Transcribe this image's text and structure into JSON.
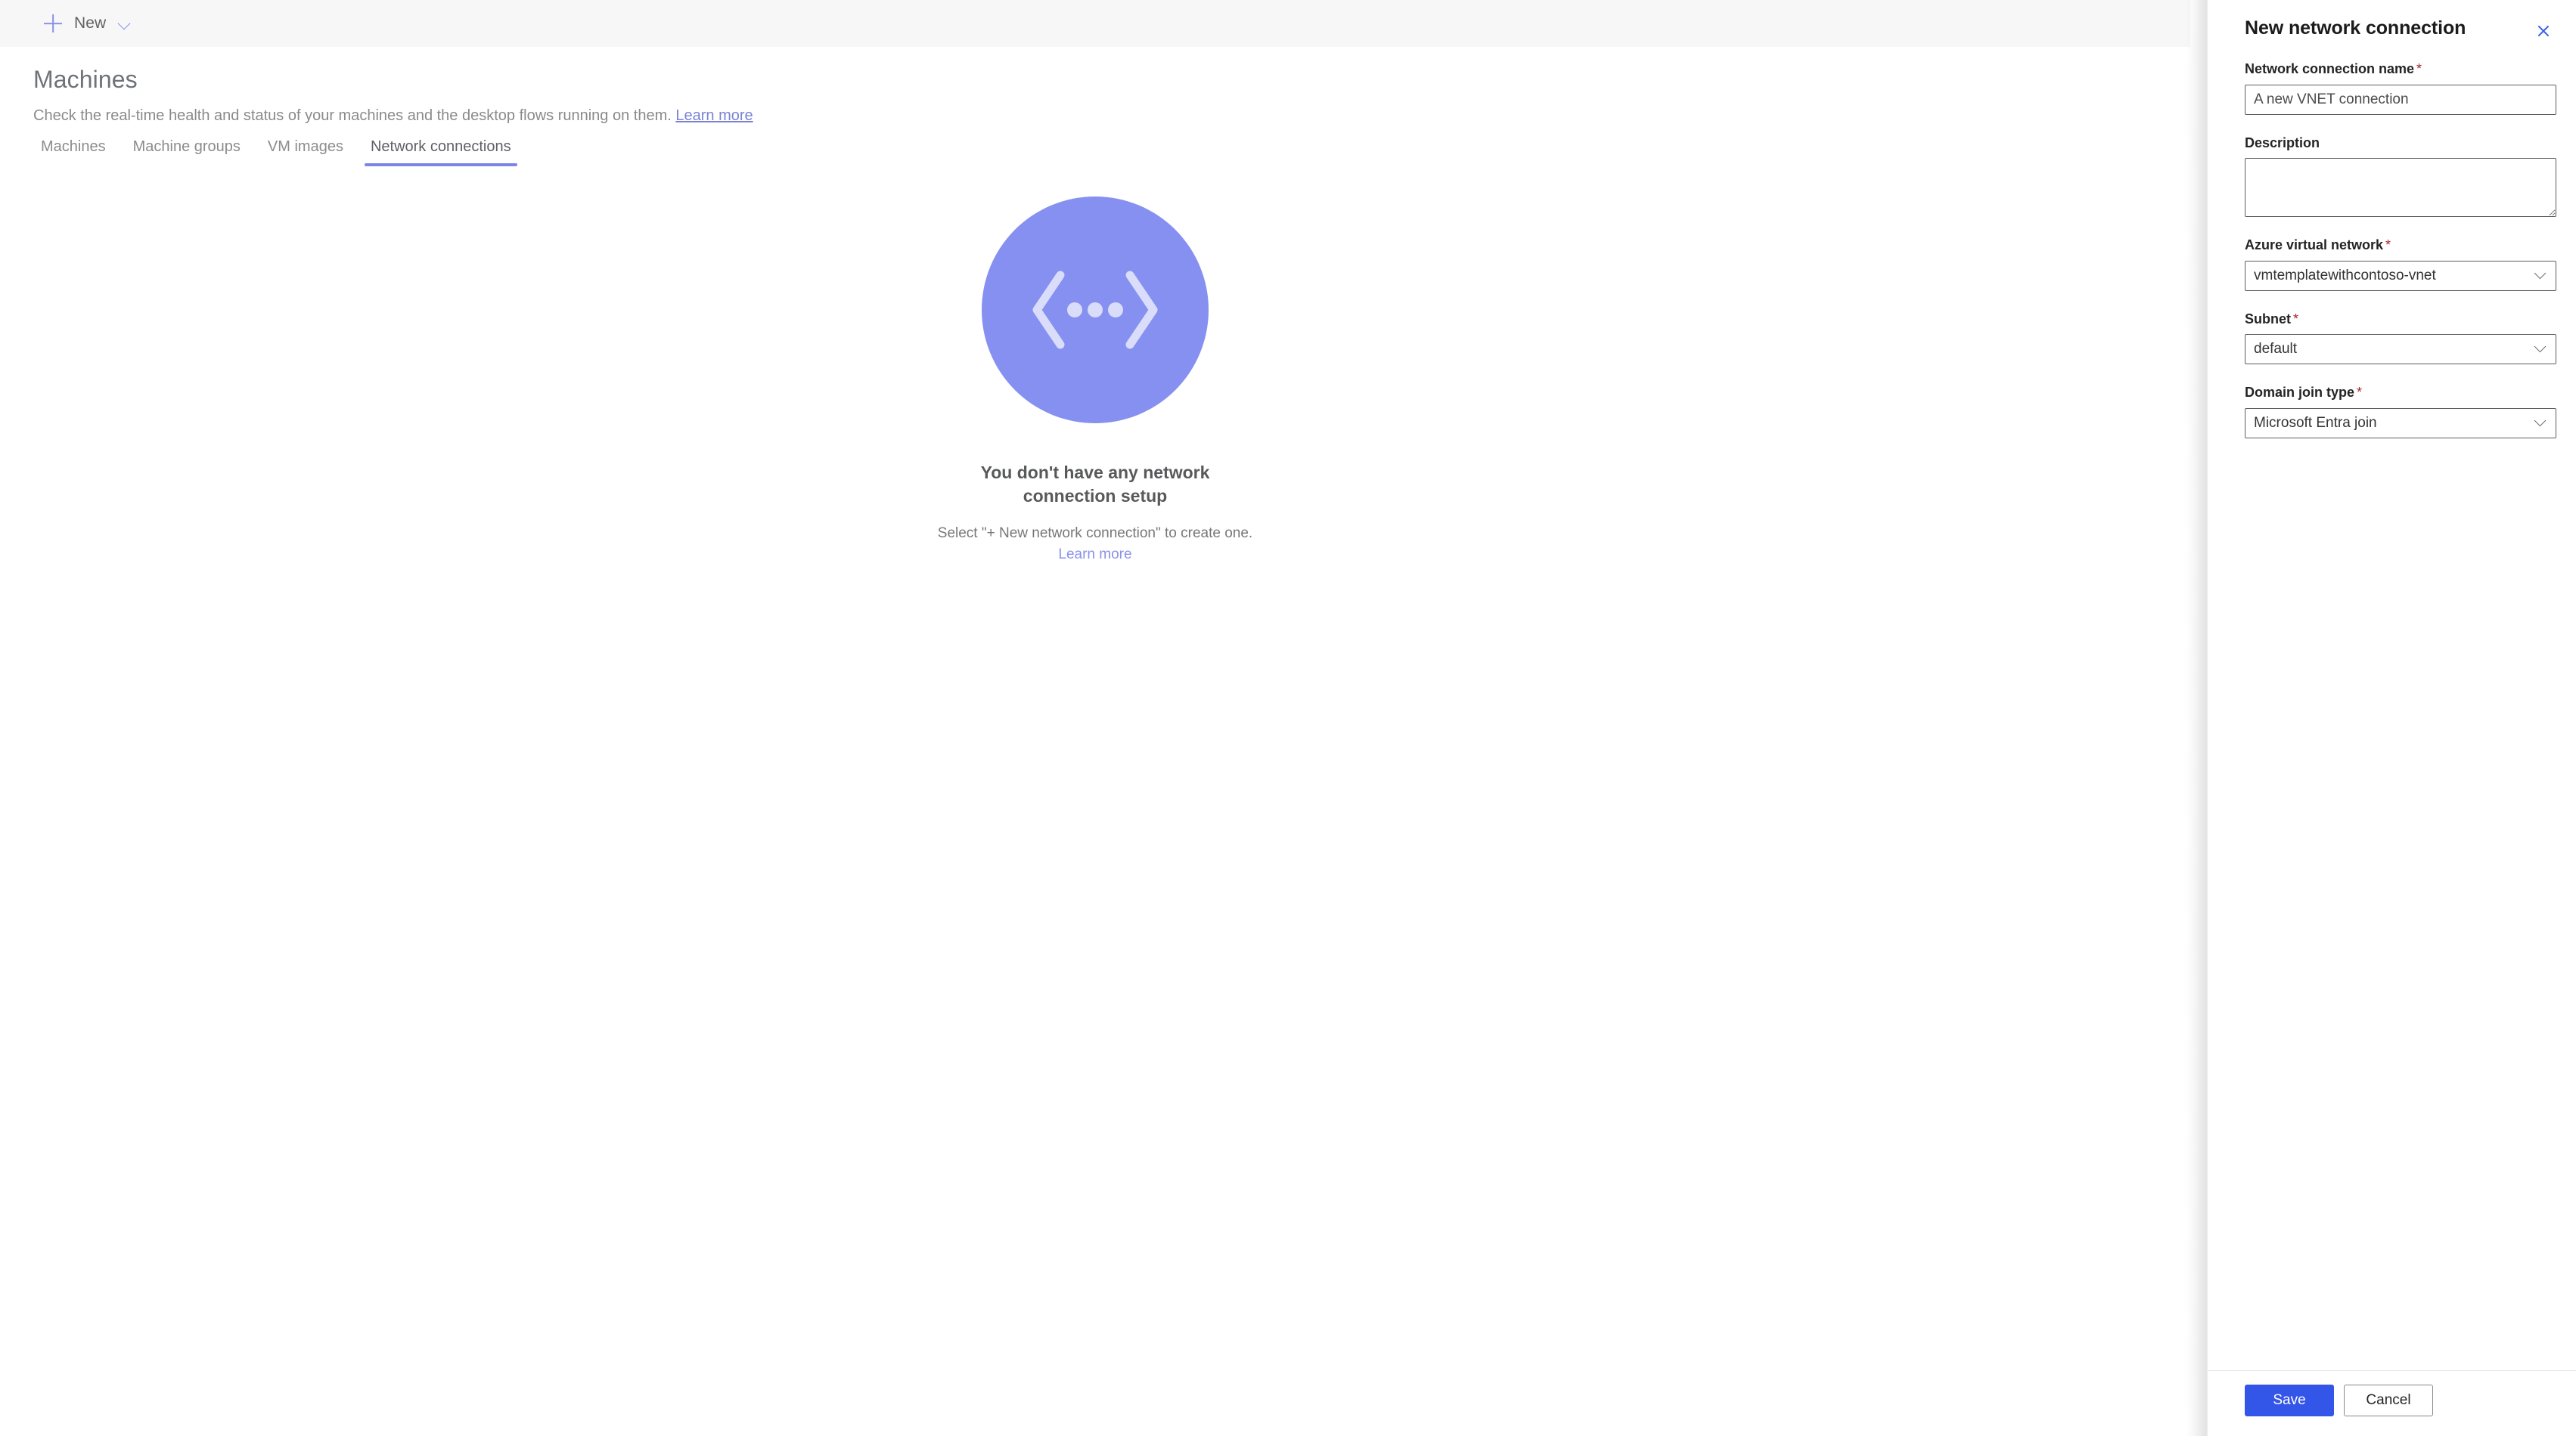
{
  "command_bar": {
    "new_button": {
      "label": "New",
      "plus_icon": "plus-icon",
      "chevron_icon": "chevron-down-icon",
      "accent_color": "#8a91e8"
    }
  },
  "page": {
    "title": "Machines",
    "subtitle_text": "Check the real-time health and status of your machines and the desktop flows running on them.",
    "subtitle_link": "Learn more"
  },
  "tabs": [
    {
      "label": "Machines",
      "active": false
    },
    {
      "label": "Machine groups",
      "active": false
    },
    {
      "label": "VM images",
      "active": false
    },
    {
      "label": "Network connections",
      "active": true
    }
  ],
  "tab_accent_color": "#7b84e8",
  "empty_state": {
    "illustration_icon": "network-connection-icon",
    "illustration_color": "#8690f0",
    "title": "You don't have any network connection setup",
    "description_text": "Select \"+ New network connection\" to create one.",
    "description_link": "Learn more"
  },
  "panel": {
    "title": "New network connection",
    "close_icon": "close-icon",
    "close_color": "#3b63e8",
    "fields": {
      "name": {
        "label": "Network connection name",
        "required": true,
        "value": "A new VNET connection",
        "placeholder": ""
      },
      "description": {
        "label": "Description",
        "required": false,
        "value": "",
        "placeholder": ""
      },
      "vnet": {
        "label": "Azure virtual network",
        "required": true,
        "value": "vmtemplatewithcontoso-vnet",
        "chevron_icon": "chevron-down-icon"
      },
      "subnet": {
        "label": "Subnet",
        "required": true,
        "value": "default",
        "chevron_icon": "chevron-down-icon"
      },
      "domain_join_type": {
        "label": "Domain join type",
        "required": true,
        "value": "Microsoft Entra join",
        "chevron_icon": "chevron-down-icon"
      }
    },
    "required_marker": "*",
    "footer": {
      "save_label": "Save",
      "cancel_label": "Cancel",
      "save_color": "#3355e8"
    }
  }
}
